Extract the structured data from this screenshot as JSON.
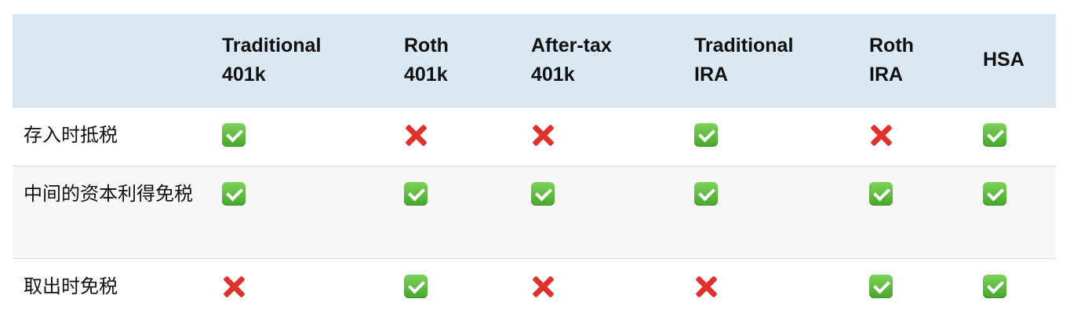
{
  "table": {
    "header": {
      "empty": "",
      "columns": [
        "Traditional\n401k",
        "Roth\n401k",
        "After-tax\n401k",
        "Traditional\nIRA",
        "Roth\nIRA",
        "HSA"
      ]
    },
    "rows": [
      {
        "label": "存入时抵税",
        "cells": [
          "check-icon",
          "cross-icon",
          "cross-icon",
          "check-icon",
          "cross-icon",
          "check-icon"
        ]
      },
      {
        "label": "中间的资本利得免税",
        "cells": [
          "check-icon",
          "check-icon",
          "check-icon",
          "check-icon",
          "check-icon",
          "check-icon"
        ]
      },
      {
        "label": "取出时免税",
        "cells": [
          "cross-icon",
          "check-icon",
          "cross-icon",
          "cross-icon",
          "check-icon",
          "check-icon"
        ]
      }
    ],
    "colors": {
      "header_background": "#d9e8f3",
      "alternate_row_background": "#f7f7f7",
      "check_green": "#55b236",
      "cross_red": "#e0322b"
    }
  }
}
